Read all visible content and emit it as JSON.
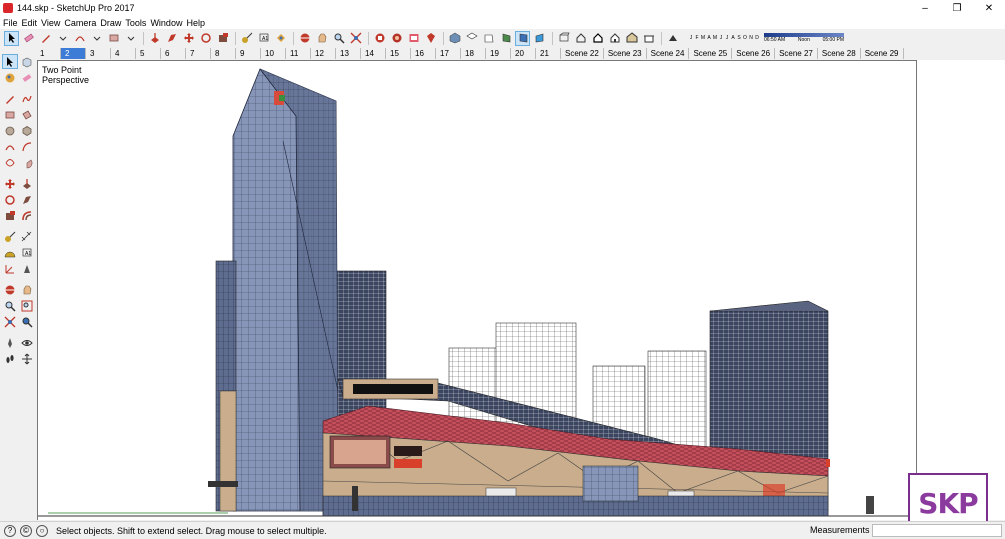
{
  "window": {
    "title": "144.skp - SketchUp Pro 2017",
    "minimize": "–",
    "maximize": "❐",
    "close": "✕"
  },
  "menu": [
    "File",
    "Edit",
    "View",
    "Camera",
    "Draw",
    "Tools",
    "Window",
    "Help"
  ],
  "shadows": {
    "months": [
      "J",
      "F",
      "M",
      "A",
      "M",
      "J",
      "J",
      "A",
      "S",
      "O",
      "N",
      "D"
    ],
    "time_start": "06:50 AM",
    "time_mid": "Noon",
    "time_end": "05:00 PM"
  },
  "scenes": [
    "1",
    "2",
    "3",
    "4",
    "5",
    "6",
    "7",
    "8",
    "9",
    "10",
    "11",
    "12",
    "13",
    "14",
    "15",
    "16",
    "17",
    "18",
    "19",
    "20",
    "21",
    "Scene 22",
    "Scene 23",
    "Scene 24",
    "Scene 25",
    "Scene 26",
    "Scene 27",
    "Scene 28",
    "Scene 29"
  ],
  "selected_scene_index": 1,
  "viewport": {
    "camera_label_line1": "Two Point",
    "camera_label_line2": "Perspective"
  },
  "watermark": "SKP",
  "status": {
    "message": "Select objects. Shift to extend select. Drag mouse to select multiple.",
    "measurements_label": "Measurements"
  },
  "colors": {
    "tower_glass": "#8796b8",
    "roof_red": "#c4505c",
    "podium_tan": "#c9ad8c",
    "selection_blue": "#3d7cd6"
  }
}
